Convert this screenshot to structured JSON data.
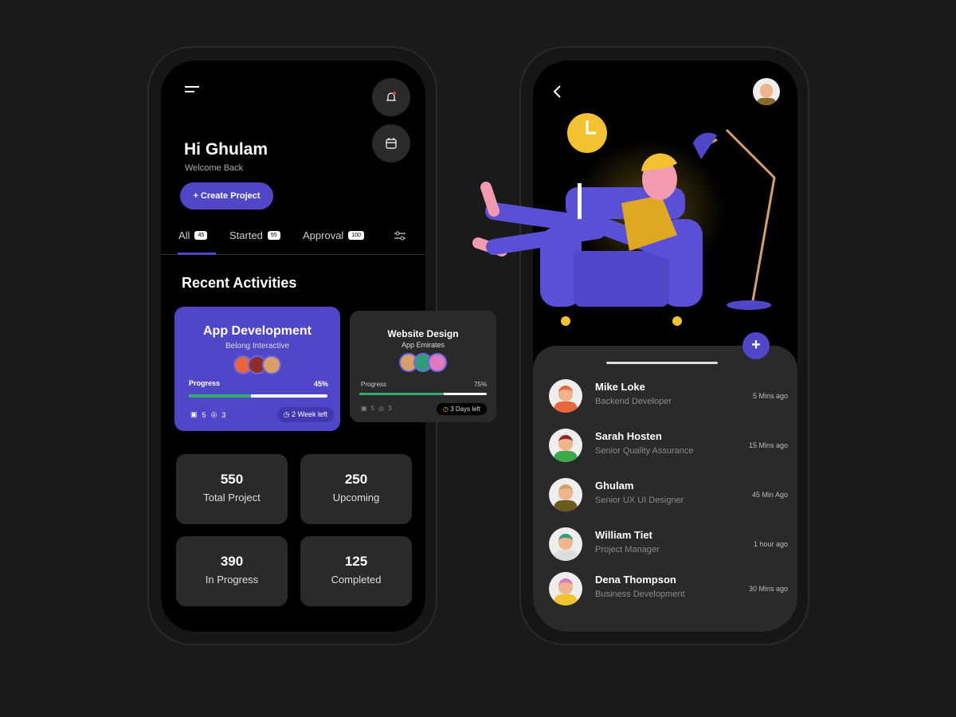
{
  "left": {
    "greeting": "Hi Ghulam",
    "subtitle": "Welcome Back",
    "create_button": "+ Create Project",
    "tabs": [
      {
        "label": "All",
        "count": "45"
      },
      {
        "label": "Started",
        "count": "55"
      },
      {
        "label": "Approval",
        "count": "100"
      }
    ],
    "section_title": "Recent Activities",
    "cards": [
      {
        "title": "App Development",
        "company": "Belong Interactive",
        "progress_label": "Progress",
        "progress": "45%",
        "files": "5",
        "comments": "3",
        "deadline": "2 Week left"
      },
      {
        "title": "Website Design",
        "company": "App Emirates",
        "progress_label": "Progress",
        "progress": "75%",
        "files": "5",
        "comments": "3",
        "deadline": "3 Days left"
      }
    ],
    "stats": [
      {
        "value": "550",
        "label": "Total Project"
      },
      {
        "value": "250",
        "label": "Upcoming"
      },
      {
        "value": "390",
        "label": "In Progress"
      },
      {
        "value": "125",
        "label": "Completed"
      }
    ]
  },
  "right": {
    "people": [
      {
        "name": "Mike Loke",
        "role": "Backend Developer",
        "time": "5 Mins ago",
        "hair": "#e8663a",
        "shirt": "#e8663a"
      },
      {
        "name": "Sarah Hosten",
        "role": "Senior Quality Assurance",
        "time": "15 Mins ago",
        "hair": "#8b2e2a",
        "shirt": "#3daa4a"
      },
      {
        "name": "Ghulam",
        "role": "Senior UX UI Designer",
        "time": "45 Min Ago",
        "hair": "#d9a066",
        "shirt": "#6b5a1e"
      },
      {
        "name": "William Tiet",
        "role": "Project Manager",
        "time": "1 hour ago",
        "hair": "#2f9e7a",
        "shirt": "#ddd"
      },
      {
        "name": "Dena Thompson",
        "role": "Business Development",
        "time": "30 Mins ago",
        "hair": "#e07ac0",
        "shirt": "#f2c230"
      }
    ]
  },
  "colors": {
    "accent": "#4f46c8",
    "progress": "#2fae6e",
    "card_dark": "#2a2a2a"
  }
}
